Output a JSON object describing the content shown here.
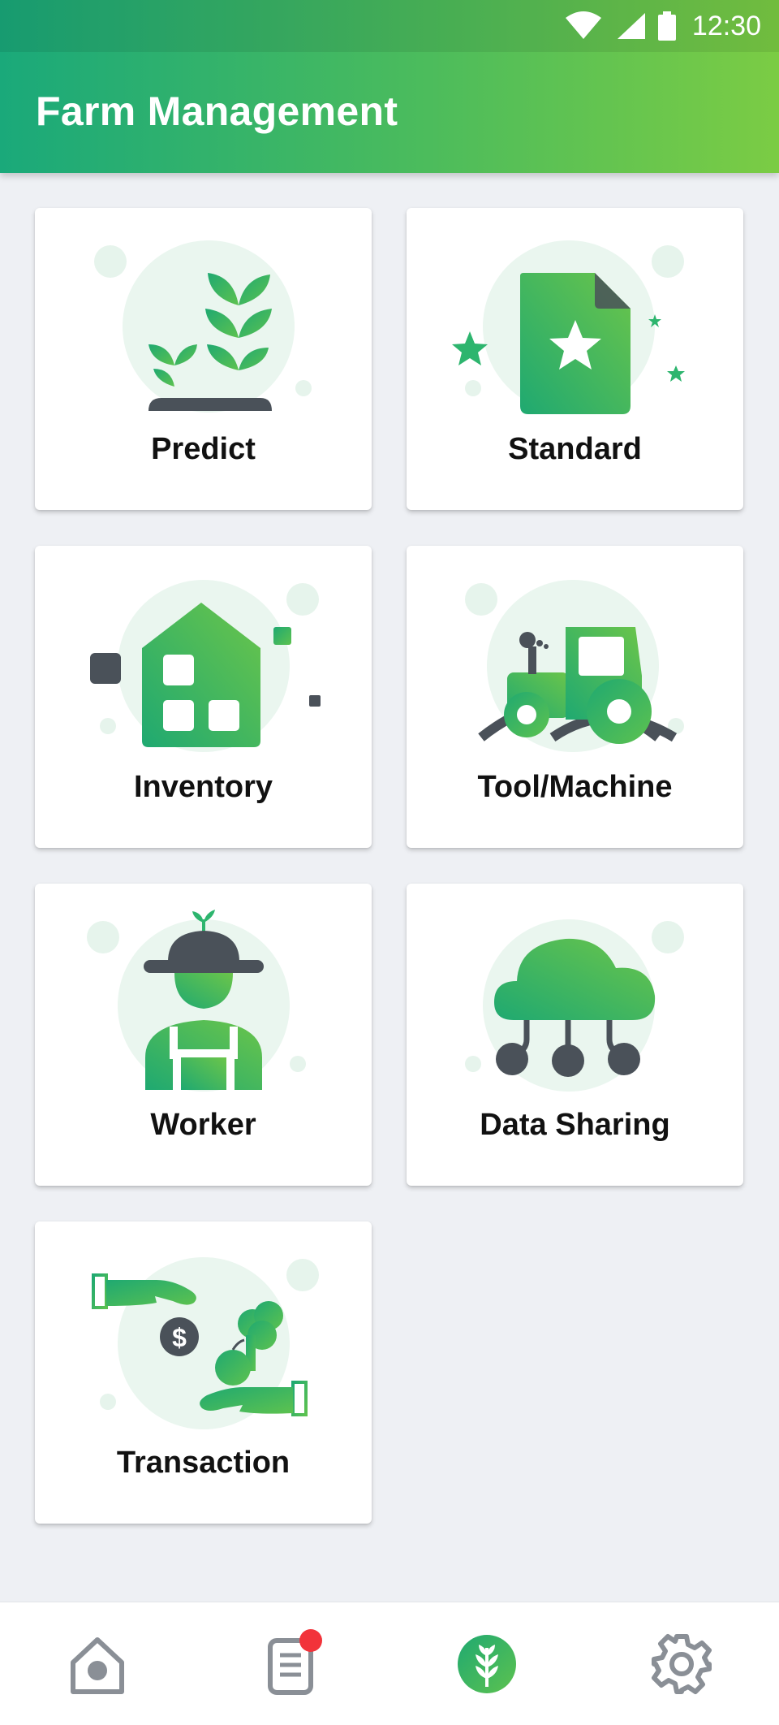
{
  "status_bar": {
    "time": "12:30",
    "icons": [
      "wifi-icon",
      "cell-signal-icon",
      "battery-icon"
    ]
  },
  "header": {
    "title": "Farm Management"
  },
  "tiles": [
    {
      "label": "Predict",
      "icon": "plant-sprout-icon"
    },
    {
      "label": "Standard",
      "icon": "star-document-icon"
    },
    {
      "label": "Inventory",
      "icon": "warehouse-icon"
    },
    {
      "label": "Tool/Machine",
      "icon": "tractor-icon"
    },
    {
      "label": "Worker",
      "icon": "farmer-icon"
    },
    {
      "label": "Data Sharing",
      "icon": "cloud-network-icon"
    },
    {
      "label": "Transaction",
      "icon": "money-exchange-icon"
    }
  ],
  "bottom_nav": {
    "items": [
      {
        "name": "home",
        "icon": "home-icon",
        "active": false
      },
      {
        "name": "notes",
        "icon": "document-icon",
        "active": false,
        "badge": true
      },
      {
        "name": "farm",
        "icon": "wheat-icon",
        "active": true
      },
      {
        "name": "settings",
        "icon": "gear-icon",
        "active": false
      }
    ]
  },
  "colors": {
    "primary_start": "#1aa97a",
    "primary_end": "#7bcc44",
    "icon_dark": "#4a5159",
    "badge": "#f2333a",
    "background": "#eef0f4"
  }
}
